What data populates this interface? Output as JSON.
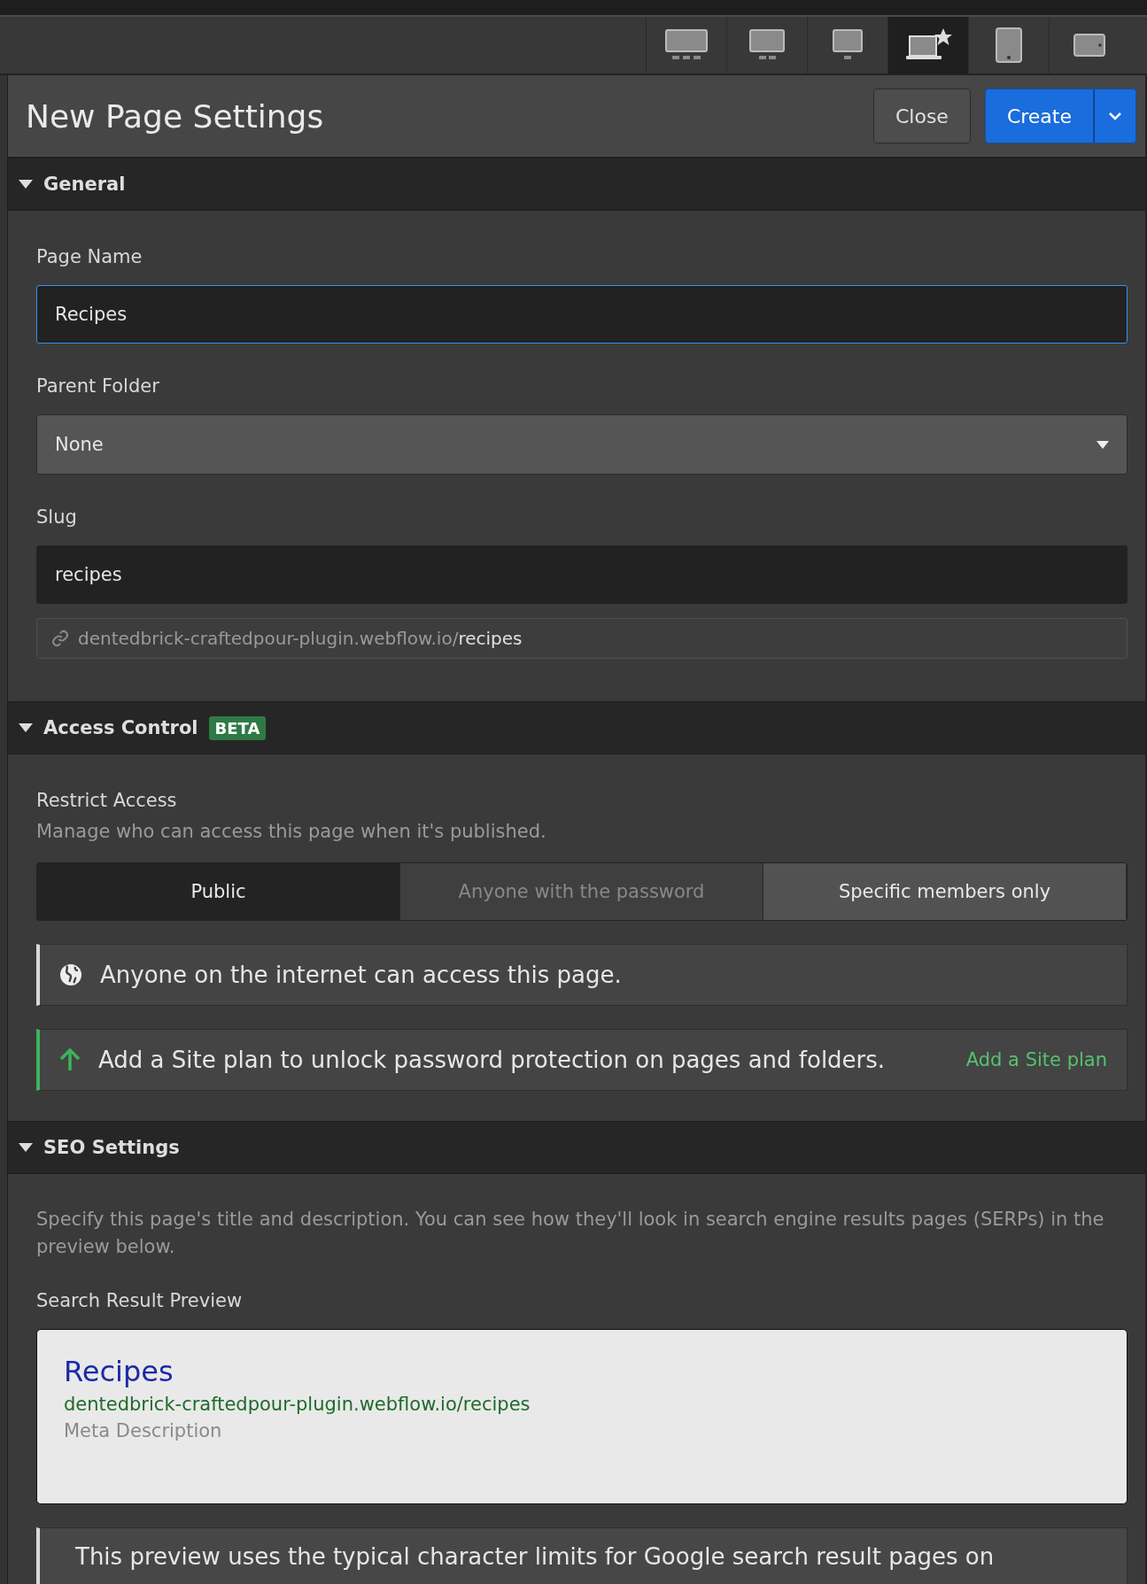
{
  "toolbar": {
    "devices": [
      {
        "kind": "desktop-xl",
        "selected": false
      },
      {
        "kind": "desktop-l",
        "selected": false
      },
      {
        "kind": "desktop",
        "selected": false
      },
      {
        "kind": "laptop-star",
        "selected": true
      },
      {
        "kind": "tablet",
        "selected": false
      },
      {
        "kind": "tablet-landscape",
        "selected": false
      }
    ]
  },
  "dialog": {
    "title": "New Page Settings",
    "close_button": "Close",
    "create_button": "Create"
  },
  "general": {
    "title": "General",
    "expanded": true,
    "page_name": {
      "label": "Page Name",
      "value": "Recipes",
      "focused": true
    },
    "parent_folder": {
      "label": "Parent Folder",
      "value": "None"
    },
    "slug": {
      "label": "Slug",
      "value": "recipes"
    },
    "url": {
      "base": "dentedbrick-craftedpour-plugin.webflow.io/",
      "path": "recipes"
    }
  },
  "access_control": {
    "title": "Access Control",
    "badge": "BETA",
    "expanded": true,
    "label": "Restrict Access",
    "description": "Manage who can access this page when it's published.",
    "options": [
      {
        "label": "Public",
        "selected": true,
        "disabled": false
      },
      {
        "label": "Anyone with the password",
        "selected": false,
        "disabled": true
      },
      {
        "label": "Specific members only",
        "selected": false,
        "disabled": false
      }
    ],
    "notices": [
      {
        "kind": "info",
        "text": "Anyone on the internet can access this page."
      },
      {
        "kind": "upgrade",
        "text": "Add a Site plan to unlock password protection on pages and folders.",
        "link": "Add a Site plan"
      }
    ]
  },
  "seo": {
    "title": "SEO Settings",
    "expanded": true,
    "description": "Specify this page's title and description. You can see how they'll look in search engine results pages (SERPs) in the preview below.",
    "preview_label": "Search Result Preview",
    "preview": {
      "title": "Recipes",
      "url": "dentedbrick-craftedpour-plugin.webflow.io/recipes",
      "description": "Meta Description"
    },
    "note": "This preview uses the typical character limits for Google search result pages on"
  }
}
